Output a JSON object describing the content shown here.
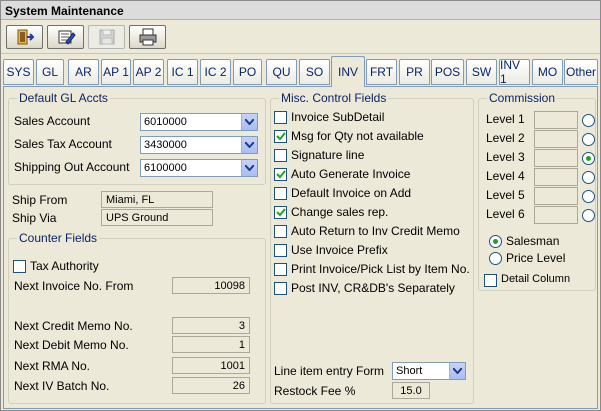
{
  "window": {
    "title": "System Maintenance"
  },
  "toolbar": {
    "buttons": [
      "exit-icon",
      "edit-icon",
      "save-icon",
      "print-icon"
    ]
  },
  "tabs": [
    "SYS",
    "GL",
    "AR",
    "AP 1",
    "AP 2",
    "IC 1",
    "IC 2",
    "PO",
    "QU",
    "SO",
    "INV",
    "FRT",
    "PR",
    "POS",
    "SW",
    "INV 1",
    "MO",
    "Other"
  ],
  "default_gl": {
    "legend": "Default GL Accts",
    "sales_account_label": "Sales Account",
    "sales_account_value": "6010000",
    "sales_tax_label": "Sales Tax Account",
    "sales_tax_value": "3430000",
    "shipping_out_label": "Shipping Out Account",
    "shipping_out_value": "6100000"
  },
  "ship": {
    "from_label": "Ship From",
    "from_value": "Miami, FL",
    "via_label": "Ship Via",
    "via_value": "UPS Ground"
  },
  "counter": {
    "legend": "Counter Fields",
    "tax_authority_label": "Tax Authority",
    "next_invoice_label": "Next Invoice No. From",
    "next_invoice_value": "10098",
    "next_credit_label": "Next Credit Memo No.",
    "next_credit_value": "3",
    "next_debit_label": "Next Debit Memo No.",
    "next_debit_value": "1",
    "next_rma_label": "Next RMA No.",
    "next_rma_value": "1001",
    "next_iv_batch_label": "Next IV Batch No.",
    "next_iv_batch_value": "26"
  },
  "misc": {
    "legend": "Misc. Control Fields",
    "checkboxes": [
      {
        "label": "Invoice SubDetail",
        "checked": false
      },
      {
        "label": "Msg for Qty not available",
        "checked": true
      },
      {
        "label": "Signature line",
        "checked": false
      },
      {
        "label": "Auto Generate Invoice",
        "checked": true
      },
      {
        "label": "Default Invoice on Add",
        "checked": false
      },
      {
        "label": "Change sales rep.",
        "checked": true
      },
      {
        "label": "Auto Return to Inv Credit Memo",
        "checked": false
      },
      {
        "label": "Use Invoice Prefix",
        "checked": false
      },
      {
        "label": "Print Invoice/Pick List by Item No.",
        "checked": false
      },
      {
        "label": "Post INV, CR&DB's Separately",
        "checked": false
      }
    ],
    "line_item_label": "Line item entry Form",
    "line_item_value": "Short",
    "restock_label": "Restock Fee %",
    "restock_value": "15.0"
  },
  "commission": {
    "legend": "Commission",
    "levels": [
      "Level 1",
      "Level 2",
      "Level 3",
      "Level 4",
      "Level 5",
      "Level 6"
    ],
    "selected_level": 3,
    "salesman_label": "Salesman",
    "price_level_label": "Price Level",
    "detail_column_label": "Detail Column"
  }
}
